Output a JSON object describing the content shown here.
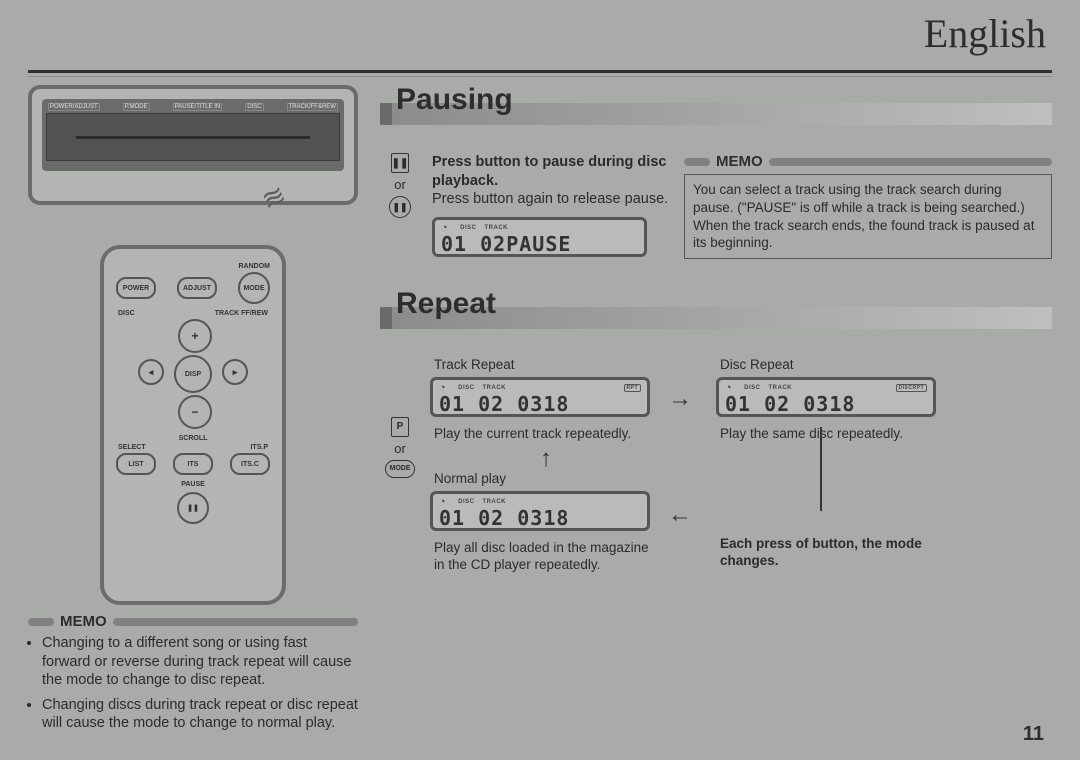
{
  "language": "English",
  "page_number": "11",
  "headunit": {
    "top_labels": [
      "POWER/ADJUST",
      "P.MODE",
      "PAUSE/TITLE IN",
      "DISC",
      "TRACK/FF&REW"
    ]
  },
  "remote": {
    "top_labels_left": "RANDOM",
    "top_labels_right": "MODE",
    "btn_power": "POWER",
    "btn_adjust": "ADJUST",
    "btn_mode": "MODE",
    "lbl_disc": "DISC",
    "lbl_track": "TRACK FF/REW",
    "dpad_center": "DISP",
    "dpad_plus": "+",
    "dpad_minus": "−",
    "dpad_left": "◂",
    "dpad_right": "▸",
    "lbl_scroll": "SCROLL",
    "lbl_select": "SELECT",
    "lbl_itsp": "ITS.P",
    "btn_list": "LIST",
    "btn_its": "ITS",
    "btn_itsc": "ITS.C",
    "lbl_pause": "PAUSE",
    "btn_pause": "❚❚"
  },
  "left_memo": {
    "heading": "MEMO",
    "items": [
      "Changing to a different song or using fast forward or reverse during track repeat will cause the mode to change to disc repeat.",
      "Changing discs during track repeat or disc repeat will cause the mode to change to normal play."
    ]
  },
  "pausing": {
    "heading": "Pausing",
    "instr_bold": "Press button to pause during disc playback.",
    "instr_line": "Press button again to release pause.",
    "icon_or": "or",
    "icon_box": "❚❚",
    "icon_round": "❚❚",
    "lcd_labels": {
      "a": "DISC",
      "b": "TRACK"
    },
    "lcd_main": "01 02PAUSE",
    "memo_heading": "MEMO",
    "memo_body": "You can select a track using the track search during pause. (\"PAUSE\" is off while a track is being searched.) When the track search ends, the found track is paused at its beginning."
  },
  "repeat": {
    "heading": "Repeat",
    "icon_box": "P",
    "icon_or": "or",
    "icon_mode": "MODE",
    "track_label": "Track Repeat",
    "track_tag": "RPT",
    "track_main": "01 02 0318",
    "track_desc": "Play the current track repeatedly.",
    "disc_label": "Disc Repeat",
    "disc_tag": "DISCRPT",
    "disc_main": "01 02 0318",
    "disc_desc": "Play the same disc repeatedly.",
    "normal_label": "Normal play",
    "normal_main": "01 02 0318",
    "normal_desc": "Play all disc loaded in the magazine in the CD player repeatedly.",
    "mode_note": "Each press of button, the mode changes.",
    "lcd_labels": {
      "a": "DISC",
      "b": "TRACK"
    }
  }
}
